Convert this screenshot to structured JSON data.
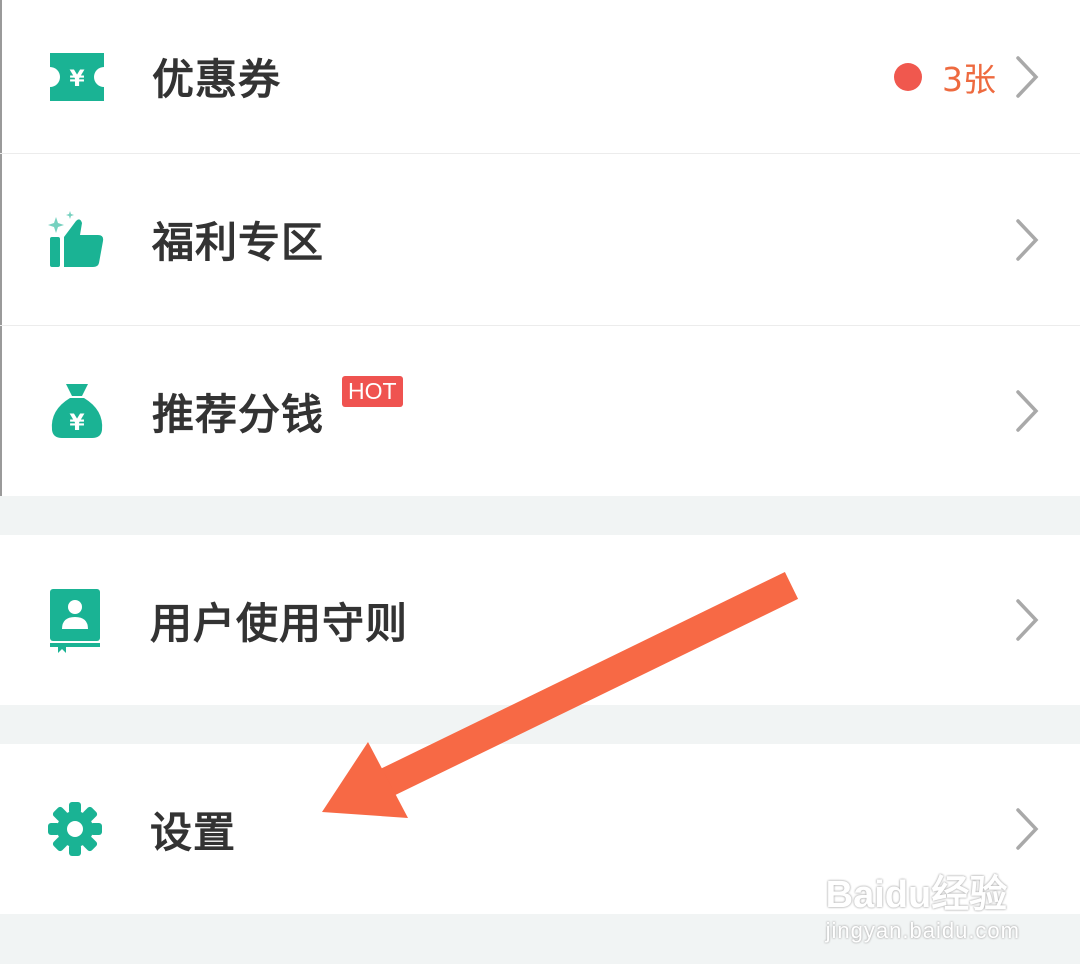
{
  "colors": {
    "accent": "#1ab394",
    "badge_red": "#f0584e",
    "count_orange": "#ee6a3f",
    "hot_red": "#ef5350",
    "arrow": "#f76945",
    "label": "#333333",
    "section_gap": "#f1f4f4"
  },
  "menu": {
    "coupons": {
      "label": "优惠券",
      "count": "3张",
      "icon": "ticket-yuan-icon"
    },
    "welfare": {
      "label": "福利专区",
      "icon": "thumbs-up-icon"
    },
    "referral": {
      "label": "推荐分钱",
      "hot": "HOT",
      "icon": "money-bag-icon"
    },
    "guidelines": {
      "label": "用户使用守则",
      "icon": "user-book-icon"
    },
    "settings": {
      "label": "设置",
      "icon": "gear-icon"
    }
  },
  "annotation": {
    "icon": "arrow-pointer-icon"
  },
  "watermark": {
    "brand": "Baidu经验",
    "url": "jingyan.baidu.com"
  }
}
